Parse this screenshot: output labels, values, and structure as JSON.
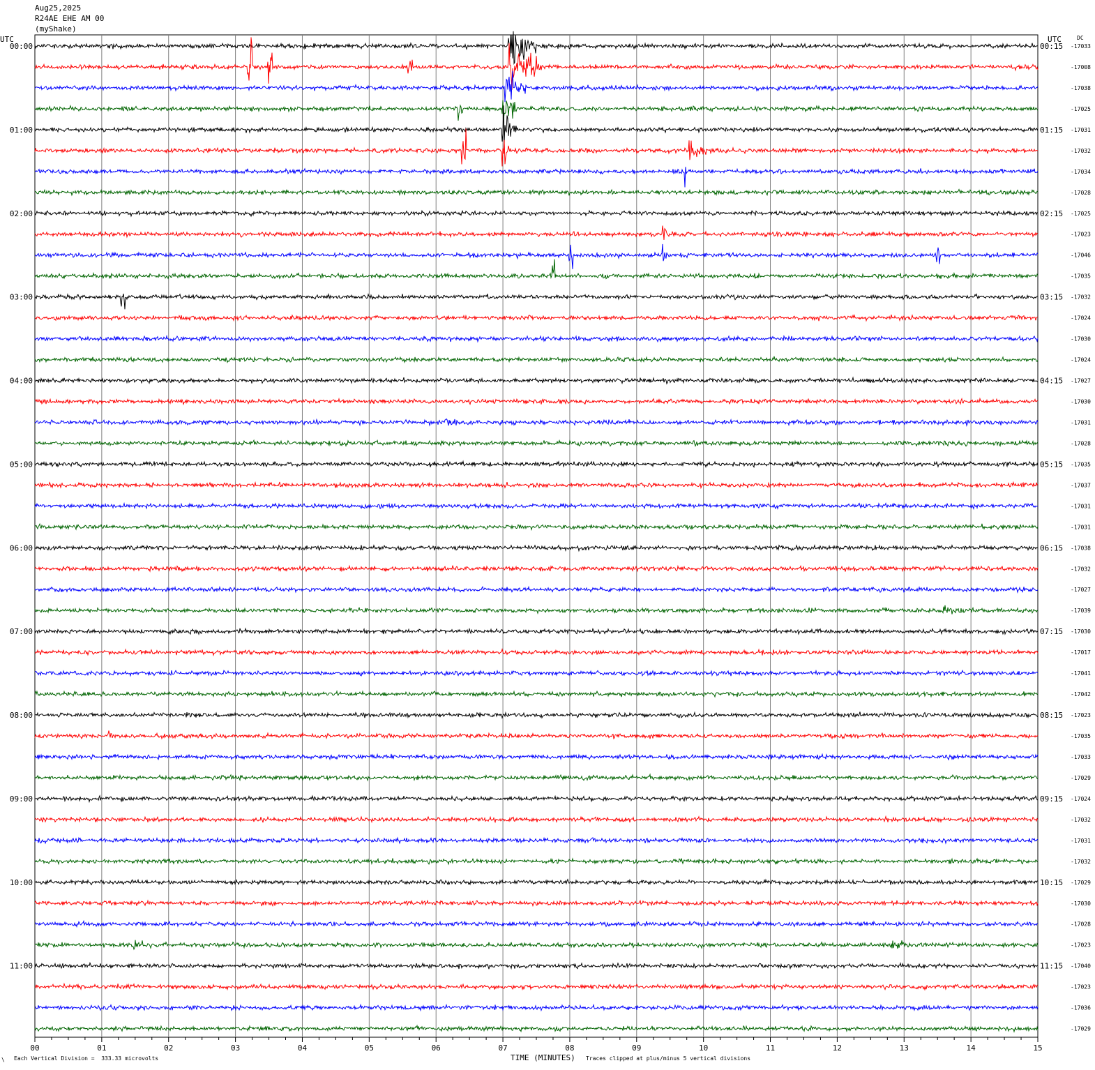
{
  "header": {
    "date": "Aug25,2025",
    "station": "R24AE EHE AM 00",
    "network": "(myShake)"
  },
  "chart_data": {
    "type": "line",
    "title": "Aug25,2025",
    "left_axis_label": "UTC",
    "right_axis_label": "UTC",
    "dc_label": "DC",
    "xlabel": "TIME (MINUTES)",
    "xlim": [
      0,
      15
    ],
    "x_tick_labels": [
      "00",
      "01",
      "02",
      "03",
      "04",
      "05",
      "06",
      "07",
      "08",
      "09",
      "10",
      "11",
      "12",
      "13",
      "14",
      "15"
    ],
    "left_hour_labels": [
      "00:00",
      "01:00",
      "02:00",
      "03:00",
      "04:00",
      "05:00",
      "06:00",
      "07:00",
      "08:00",
      "09:00",
      "10:00",
      "11:00"
    ],
    "right_hour_labels": [
      "00:15",
      "01:15",
      "02:15",
      "03:15",
      "04:15",
      "05:15",
      "06:15",
      "07:15",
      "08:15",
      "09:15",
      "10:15",
      "11:15"
    ],
    "rows_per_hour": 4,
    "trace_colors": [
      "#000000",
      "#ff0000",
      "#0000ff",
      "#006400"
    ],
    "dc_offsets": [
      "-17033",
      "-17008",
      "-17038",
      "-17025",
      "-17031",
      "-17032",
      "-17034",
      "-17028",
      "-17025",
      "-17023",
      "-17046",
      "-17035",
      "-17032",
      "-17024",
      "-17030",
      "-17024",
      "-17027",
      "-17030",
      "-17031",
      "-17028",
      "-17035",
      "-17037",
      "-17031",
      "-17031",
      "-17038",
      "-17032",
      "-17027",
      "-17039",
      "-17030",
      "-17017",
      "-17041",
      "-17042",
      "-17023",
      "-17035",
      "-17033",
      "-17029",
      "-17024",
      "-17032",
      "-17031",
      "-17032",
      "-17029",
      "-17030",
      "-17028",
      "-17023",
      "-17040",
      "-17023",
      "-17036",
      "-17029"
    ],
    "events": [
      {
        "row": 0,
        "minute": 7.1,
        "duration": 0.4,
        "amplitude": 5
      },
      {
        "row": 1,
        "minute": 7.1,
        "duration": 0.5,
        "amplitude": 5
      },
      {
        "row": 1,
        "minute": 3.2,
        "duration": 0.05,
        "amplitude": 5
      },
      {
        "row": 1,
        "minute": 3.5,
        "duration": 0.05,
        "amplitude": 4
      },
      {
        "row": 1,
        "minute": 5.6,
        "duration": 0.05,
        "amplitude": 3
      },
      {
        "row": 2,
        "minute": 7.05,
        "duration": 0.3,
        "amplitude": 4
      },
      {
        "row": 3,
        "minute": 7.0,
        "duration": 0.2,
        "amplitude": 5
      },
      {
        "row": 3,
        "minute": 6.35,
        "duration": 0.05,
        "amplitude": 3
      },
      {
        "row": 4,
        "minute": 7.0,
        "duration": 0.2,
        "amplitude": 5
      },
      {
        "row": 5,
        "minute": 7.0,
        "duration": 0.1,
        "amplitude": 5
      },
      {
        "row": 5,
        "minute": 9.8,
        "duration": 0.4,
        "amplitude": 1.5
      },
      {
        "row": 5,
        "minute": 6.4,
        "duration": 0.05,
        "amplitude": 3
      },
      {
        "row": 6,
        "minute": 9.7,
        "duration": 0.05,
        "amplitude": 2
      },
      {
        "row": 9,
        "minute": 9.4,
        "duration": 0.05,
        "amplitude": 2
      },
      {
        "row": 10,
        "minute": 9.4,
        "duration": 0.05,
        "amplitude": 3
      },
      {
        "row": 10,
        "minute": 8.0,
        "duration": 0.05,
        "amplitude": 3
      },
      {
        "row": 10,
        "minute": 13.5,
        "duration": 0.05,
        "amplitude": 3
      },
      {
        "row": 11,
        "minute": 7.75,
        "duration": 0.05,
        "amplitude": 3
      },
      {
        "row": 12,
        "minute": 1.3,
        "duration": 0.05,
        "amplitude": 1.5
      },
      {
        "row": 18,
        "minute": 6.15,
        "duration": 0.3,
        "amplitude": 1.2
      },
      {
        "row": 27,
        "minute": 11.55,
        "duration": 0.15,
        "amplitude": 1
      },
      {
        "row": 27,
        "minute": 13.6,
        "duration": 0.8,
        "amplitude": 0.7
      },
      {
        "row": 33,
        "minute": 1.1,
        "duration": 0.1,
        "amplitude": 1
      },
      {
        "row": 43,
        "minute": 12.8,
        "duration": 0.6,
        "amplitude": 1
      },
      {
        "row": 43,
        "minute": 1.5,
        "duration": 0.3,
        "amplitude": 0.8
      }
    ]
  },
  "footer": {
    "scale_note": "Each Vertical Division =  333.33 microvolts",
    "clip_note": "Traces clipped at plus/minus 5 vertical divisions"
  }
}
